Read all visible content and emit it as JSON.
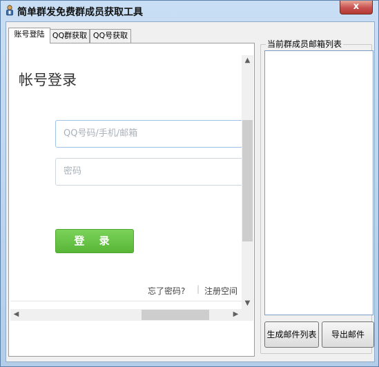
{
  "window": {
    "title": "简单群发免费群成员获取工具",
    "close_label": "x"
  },
  "tabs": [
    {
      "label": "账号登陆",
      "active": true
    },
    {
      "label": "QQ群获取",
      "active": false
    },
    {
      "label": "QQ号获取",
      "active": false
    }
  ],
  "login": {
    "title": "帐号登录",
    "account_placeholder": "QQ号码/手机/邮箱",
    "password_placeholder": "密码",
    "login_button": "登 录",
    "forgot_link": "忘了密码?",
    "separator": "|",
    "register_link": "注册空间"
  },
  "scroll": {
    "up": "▲",
    "down": "▼",
    "left": "◀",
    "right": "▶"
  },
  "email_panel": {
    "group_label": "当前群成员邮箱列表",
    "items": [],
    "generate_button": "生成邮件列表",
    "export_button": "导出邮件"
  },
  "colors": {
    "login_button": "#58b637",
    "title_bar": "#c9def4",
    "close_button": "#c75050"
  }
}
